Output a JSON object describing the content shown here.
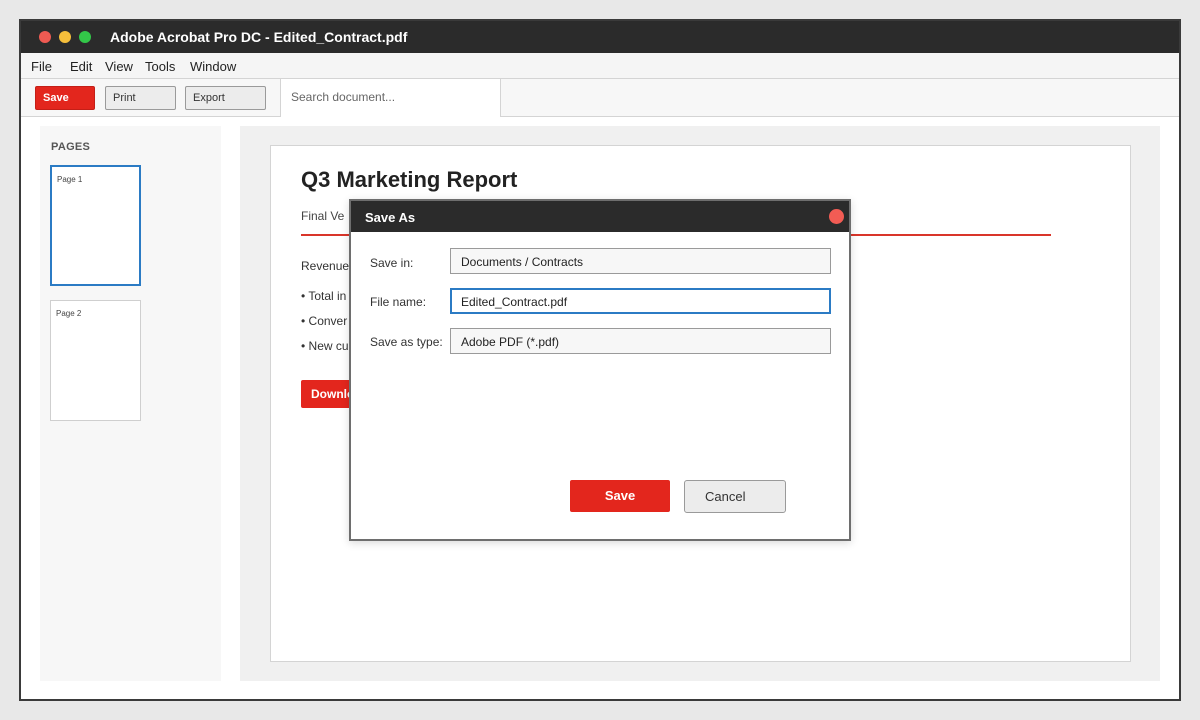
{
  "window": {
    "title": "Adobe Acrobat Pro DC - Edited_Contract.pdf"
  },
  "menu": {
    "items": [
      "File",
      "Edit",
      "View",
      "Tools",
      "Window"
    ]
  },
  "toolbar": {
    "save_label": "Save",
    "print_label": "Print",
    "export_label": "Export",
    "search_placeholder": "Search document..."
  },
  "sidebar": {
    "heading": "PAGES",
    "pages": [
      {
        "label": "Page 1",
        "selected": true
      },
      {
        "label": "Page 2",
        "selected": false
      }
    ]
  },
  "document": {
    "title": "Q3 Marketing Report",
    "subtitle": "Final Ve",
    "section": "Revenue",
    "bullets": [
      "• Total in",
      "• Conver",
      "• New cu"
    ],
    "button_label": "Downlo"
  },
  "dialog": {
    "title": "Save As",
    "save_in_label": "Save in:",
    "save_in_value": "Documents / Contracts",
    "file_name_label": "File name:",
    "file_name_value": "Edited_Contract.pdf",
    "type_label": "Save as type:",
    "type_value": "Adobe PDF (*.pdf)",
    "save_label": "Save",
    "cancel_label": "Cancel"
  },
  "colors": {
    "accent_red": "#e3261d",
    "focus_blue": "#2b7bc4",
    "titlebar": "#2b2b2b"
  }
}
